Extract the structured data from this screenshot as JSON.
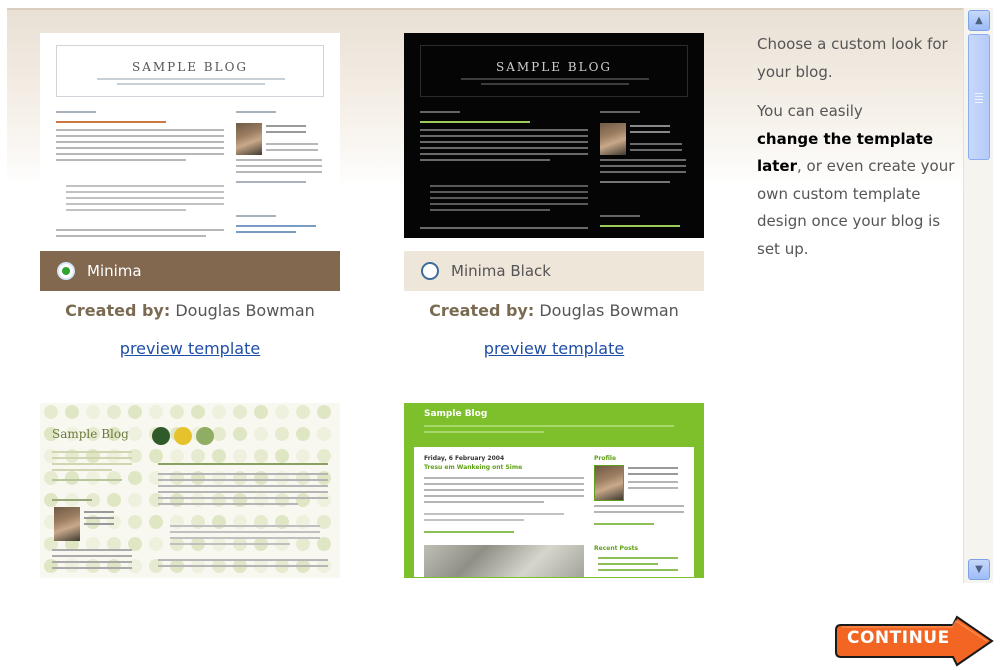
{
  "templates": [
    {
      "name": "Minima",
      "selected": true,
      "creator_label": "Created by:",
      "creator": "Douglas Bowman",
      "preview_label": "preview template",
      "thumb_title": "SAMPLE BLOG"
    },
    {
      "name": "Minima Black",
      "selected": false,
      "creator_label": "Created by:",
      "creator": "Douglas Bowman",
      "preview_label": "preview template",
      "thumb_title": "SAMPLE BLOG"
    },
    {
      "name": "",
      "thumb_title": "Sample Blog"
    },
    {
      "name": "",
      "thumb_title": "Sample Blog",
      "thumb_date": "Friday, 6 February 2004",
      "thumb_post": "Tresu em Wankeing ont Sime",
      "thumb_profile": "Profile",
      "thumb_recent": "Recent Posts"
    }
  ],
  "info": {
    "line1": "Choose a custom look for your blog.",
    "line2_pre": "You can easily",
    "line2_bold": "change the template later",
    "line2_post": ", or even create your own custom template design once your blog is set up."
  },
  "buttons": {
    "continue": "CONTINUE"
  },
  "colors": {
    "selected_bar": "#81684f",
    "unselected_bar": "#efe6da",
    "link": "#1f4ea6",
    "continue_bg": "#f26522"
  }
}
